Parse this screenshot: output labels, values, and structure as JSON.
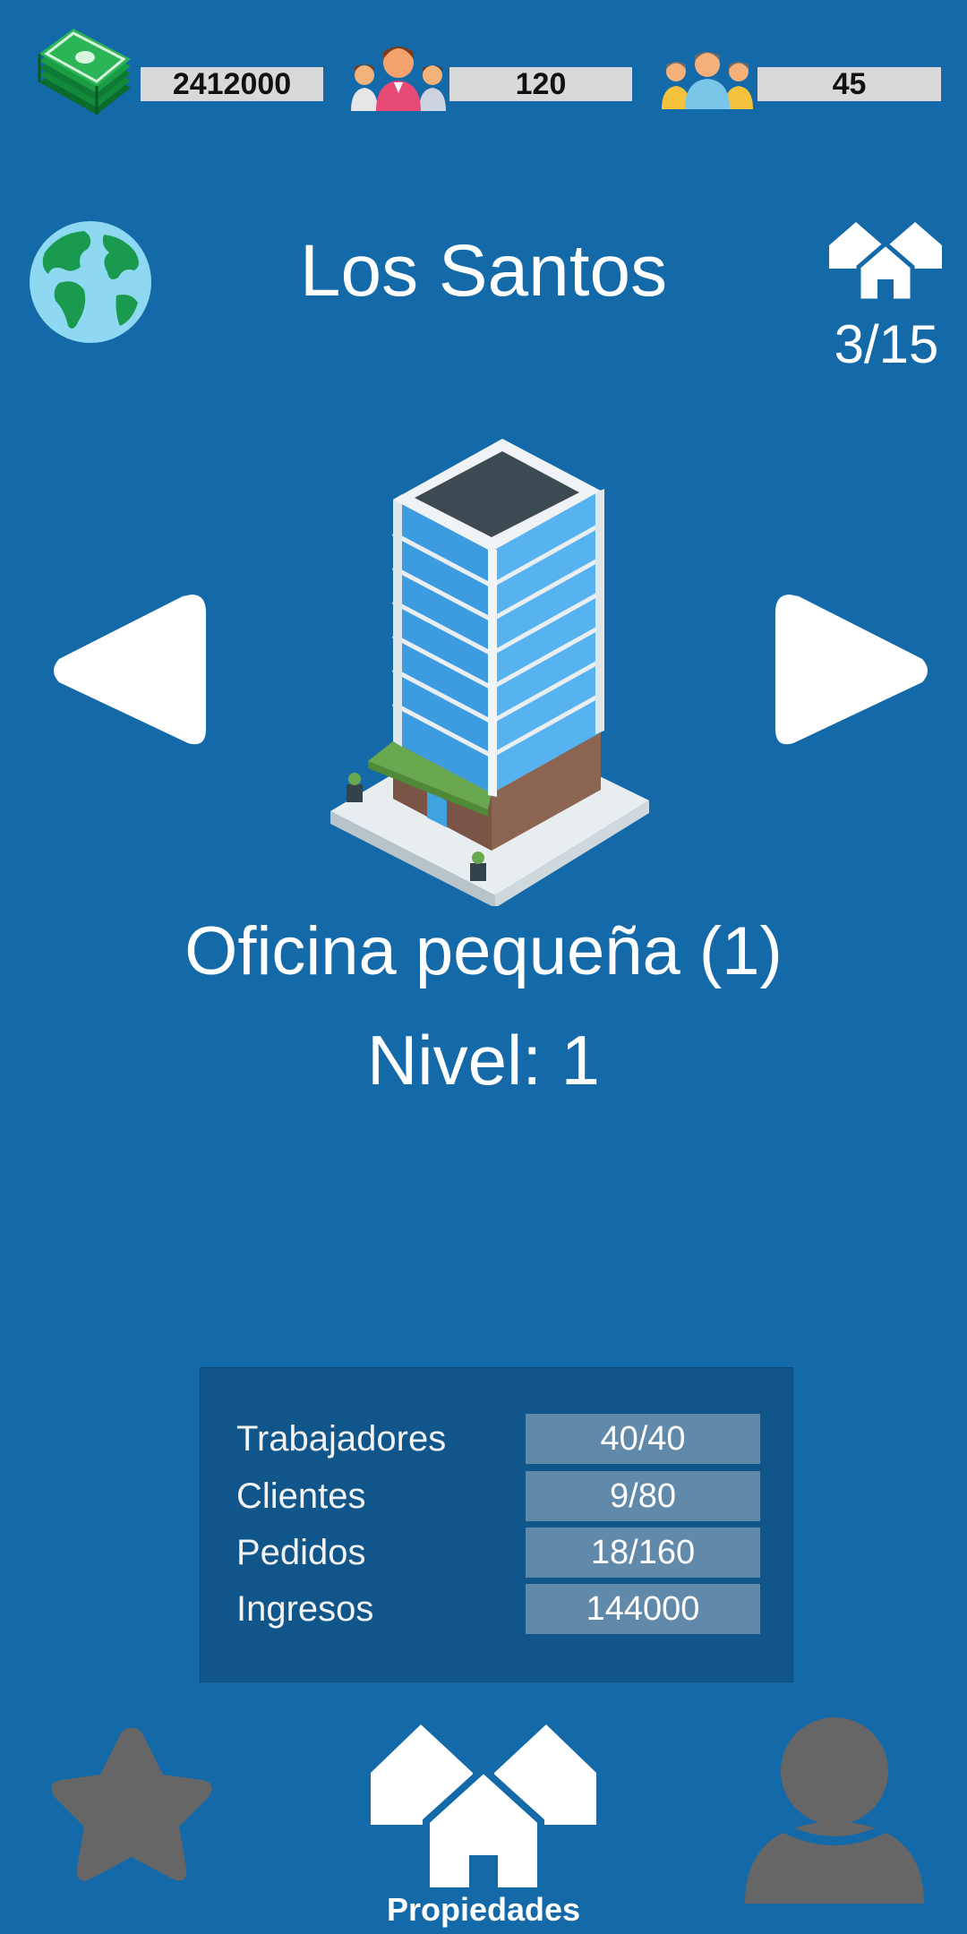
{
  "resources": {
    "money": "2412000",
    "workers": "120",
    "clients": "45"
  },
  "header": {
    "city_name": "Los Santos",
    "properties_count": "3/15"
  },
  "building": {
    "name": "Oficina pequeña (1)",
    "level": "Nivel: 1"
  },
  "stats": [
    {
      "label": "Trabajadores",
      "value": "40/40"
    },
    {
      "label": "Clientes",
      "value": "9/80"
    },
    {
      "label": "Pedidos",
      "value": "18/160"
    },
    {
      "label": "Ingresos",
      "value": "144000"
    }
  ],
  "bottom_nav": {
    "properties_label": "Propiedades"
  },
  "colors": {
    "background": "#1469a8",
    "panel": "#10568a",
    "value_box": "#6189aa",
    "inactive_icon": "#666666"
  },
  "icons": {
    "money": "money-stack-icon",
    "workers": "workers-icon",
    "clients": "clients-icon",
    "world": "globe-icon",
    "properties": "houses-icon",
    "prev": "arrow-left-icon",
    "next": "arrow-right-icon",
    "favorites": "star-icon",
    "profile": "user-icon"
  }
}
